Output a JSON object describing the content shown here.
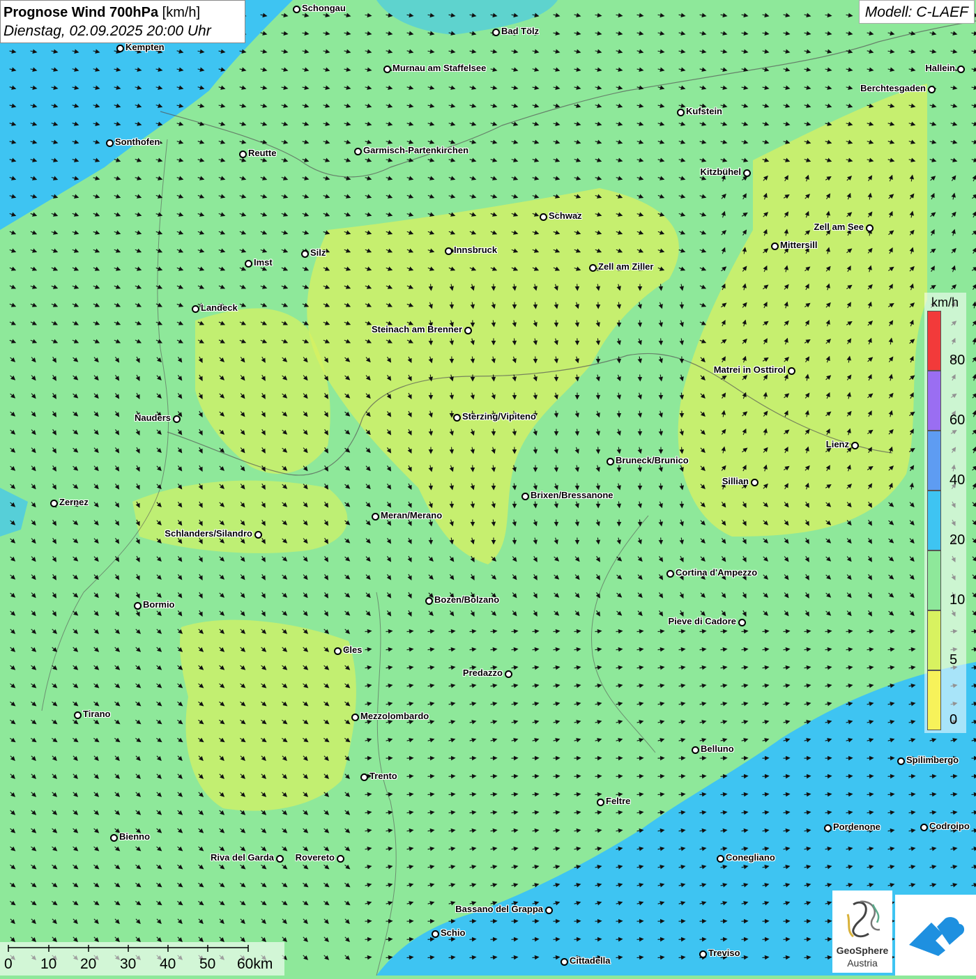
{
  "title": {
    "main": "Prognose Wind 700hPa",
    "unit": "[km/h]",
    "datetime": "Dienstag, 02.09.2025 20:00 Uhr"
  },
  "model": "Modell: C-LAEF",
  "legend": {
    "unit": "km/h",
    "labels": [
      "80",
      "60",
      "40",
      "20",
      "10",
      "5",
      "0"
    ],
    "colors": [
      "#f23a3a",
      "#9a6ef2",
      "#5e9cf2",
      "#3ec4f2",
      "#8ee89a",
      "#d8f260",
      "#f7f25a"
    ]
  },
  "scale": {
    "labels": [
      "0",
      "10",
      "20",
      "30",
      "40",
      "50",
      "60km"
    ]
  },
  "cities": [
    {
      "name": "Schongau"
    },
    {
      "name": "Bad Tölz"
    },
    {
      "name": "Kempten"
    },
    {
      "name": "Murnau am Staffelsee"
    },
    {
      "name": "Hallein"
    },
    {
      "name": "Berchtesgaden"
    },
    {
      "name": "Kufstein"
    },
    {
      "name": "Sonthofen"
    },
    {
      "name": "Reutte"
    },
    {
      "name": "Garmisch-Partenkirchen"
    },
    {
      "name": "Kitzbühel"
    },
    {
      "name": "Schwaz"
    },
    {
      "name": "Zell am See"
    },
    {
      "name": "Mittersill"
    },
    {
      "name": "Innsbruck"
    },
    {
      "name": "Silz"
    },
    {
      "name": "Imst"
    },
    {
      "name": "Zell am Ziller"
    },
    {
      "name": "Landeck"
    },
    {
      "name": "Steinach am Brenner"
    },
    {
      "name": "Matrei in Osttirol"
    },
    {
      "name": "Nauders"
    },
    {
      "name": "Sterzing/Vipiteno"
    },
    {
      "name": "Lienz"
    },
    {
      "name": "Bruneck/Brunico"
    },
    {
      "name": "Sillian"
    },
    {
      "name": "Brixen/Bressanone"
    },
    {
      "name": "Zernez"
    },
    {
      "name": "Meran/Merano"
    },
    {
      "name": "Schlanders/Silandro"
    },
    {
      "name": "Cortina d'Ampezzo"
    },
    {
      "name": "Bozen/Bolzano"
    },
    {
      "name": "Bormio"
    },
    {
      "name": "Pieve di Cadore"
    },
    {
      "name": "Cles"
    },
    {
      "name": "Predazzo"
    },
    {
      "name": "Tirano"
    },
    {
      "name": "Mezzolombardo"
    },
    {
      "name": "Belluno"
    },
    {
      "name": "Spilimbergo"
    },
    {
      "name": "Trento"
    },
    {
      "name": "Feltre"
    },
    {
      "name": "Bienno"
    },
    {
      "name": "Pordenone"
    },
    {
      "name": "Codroipo"
    },
    {
      "name": "Riva del Garda"
    },
    {
      "name": "Rovereto"
    },
    {
      "name": "Conegliano"
    },
    {
      "name": "Bassano del Grappa"
    },
    {
      "name": "Schio"
    },
    {
      "name": "Treviso"
    },
    {
      "name": "Cittadella"
    }
  ],
  "logos": {
    "geosphere_line1": "GeoSphere",
    "geosphere_line2": "Austria"
  }
}
